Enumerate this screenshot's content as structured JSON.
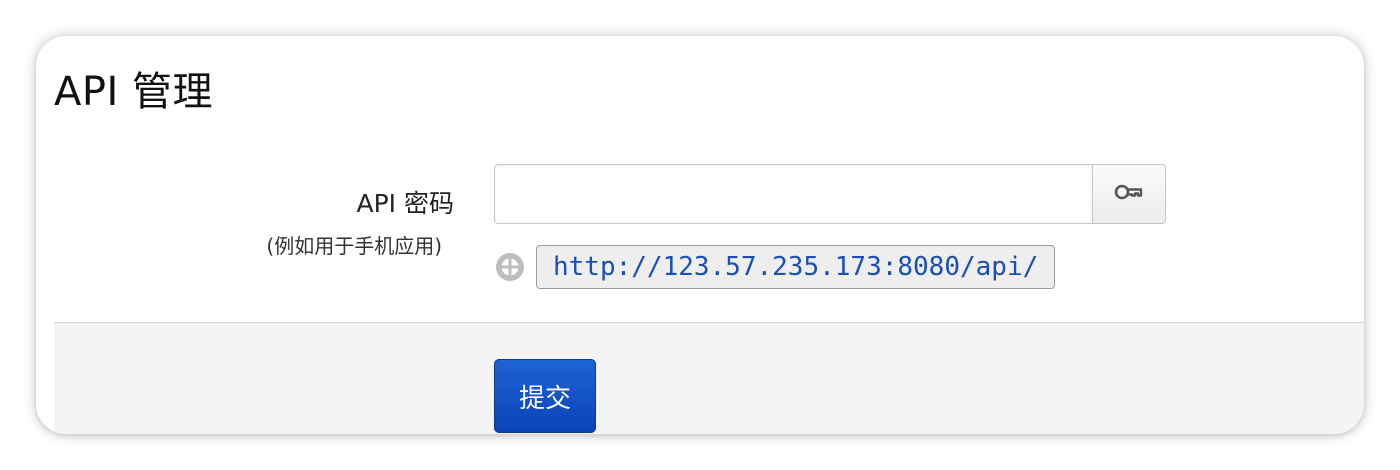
{
  "page": {
    "title": "API 管理"
  },
  "form": {
    "api_key_label": "API 密码",
    "api_key_hint": "(例如用于手机应用)",
    "api_key_value": "",
    "key_button_icon": "key-icon",
    "url_icon": "globe-icon",
    "api_url": "http://123.57.235.173:8080/api/"
  },
  "footer": {
    "submit_label": "提交"
  },
  "colors": {
    "submit_button": "#0a43b8",
    "url_text": "#1a4fb8",
    "footer_background": "#f4f4f4"
  }
}
